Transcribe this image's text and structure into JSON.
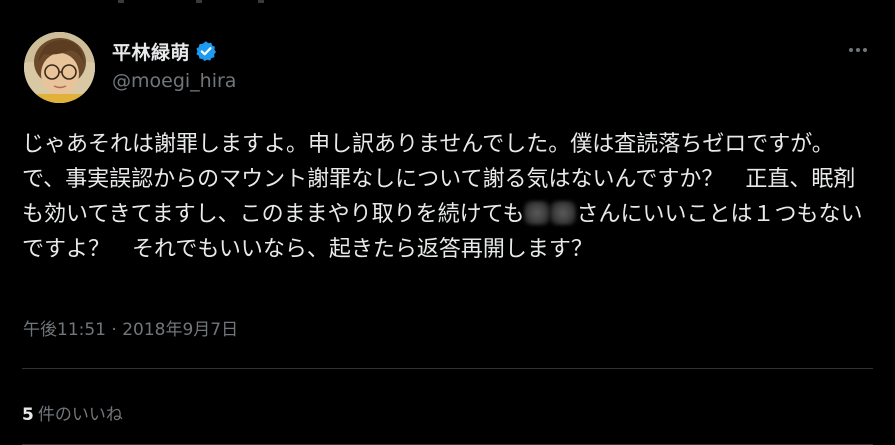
{
  "author": {
    "display_name": "平林緑萌",
    "handle": "@moegi_hira",
    "verified": true,
    "avatar_icon": "user-avatar",
    "verified_icon": "verified-badge-icon",
    "verified_color": "#1d9bf0"
  },
  "menu": {
    "more_icon": "more-options-icon"
  },
  "tweet": {
    "text_part1": "じゃあそれは謝罪しますよ。申し訳ありませんでした。僕は査読落ちゼロですが。で、事実誤認からのマウント謝罪なしについて謝る気はないんですか？　正直、眠剤も効いてきてますし、このままやり取りを続けても",
    "text_part2": "さんにいいことは１つもないですよ？　それでもいいなら、起きたら返答再開します？",
    "redacted_icon": "redacted-blur",
    "timestamp": "午後11:51 · 2018年9月7日"
  },
  "stats": {
    "likes_count": "5",
    "likes_label": "件のいいね"
  },
  "colors": {
    "background": "#000000",
    "text_primary": "#e7e9ea",
    "text_secondary": "#71767b",
    "divider": "#2f3336"
  }
}
